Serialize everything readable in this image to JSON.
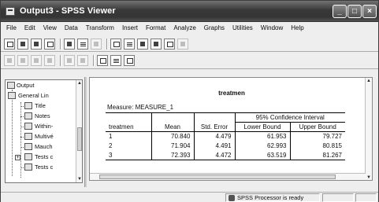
{
  "window": {
    "title": "Output3 - SPSS Viewer",
    "controls": {
      "minimize": "_",
      "maximize": "□",
      "close": "×"
    }
  },
  "menu": [
    "File",
    "Edit",
    "View",
    "Data",
    "Transform",
    "Insert",
    "Format",
    "Analyze",
    "Graphs",
    "Utilities",
    "Window",
    "Help"
  ],
  "outline": {
    "items": [
      {
        "label": "Output",
        "icon": "output-book-icon"
      },
      {
        "label": "General Lin",
        "icon": "book-icon"
      },
      {
        "label": "Title",
        "icon": "document-icon"
      },
      {
        "label": "Notes",
        "icon": "notes-icon"
      },
      {
        "label": "Within-",
        "icon": "table-icon"
      },
      {
        "label": "Multivé",
        "icon": "table-icon"
      },
      {
        "label": "Mauch",
        "icon": "table-icon"
      },
      {
        "label": "Tests c",
        "icon": "table-icon"
      },
      {
        "label": "Tests c",
        "icon": "table-icon"
      }
    ]
  },
  "table": {
    "caption": "treatmen",
    "measure": "Measure: MEASURE_1",
    "headers": {
      "row_label": "treatmen",
      "mean": "Mean",
      "std_error": "Std. Error",
      "ci_group": "95% Confidence Interval",
      "lower": "Lower Bound",
      "upper": "Upper Bound"
    },
    "rows": [
      {
        "treatmen": "1",
        "mean": "70.840",
        "std_error": "4.479",
        "lower": "61.953",
        "upper": "79.727"
      },
      {
        "treatmen": "2",
        "mean": "71.904",
        "std_error": "4.491",
        "lower": "62.993",
        "upper": "80.815"
      },
      {
        "treatmen": "3",
        "mean": "72.393",
        "std_error": "4.472",
        "lower": "63.519",
        "upper": "81.267"
      }
    ]
  },
  "status": {
    "text": "SPSS Processor  is ready"
  }
}
